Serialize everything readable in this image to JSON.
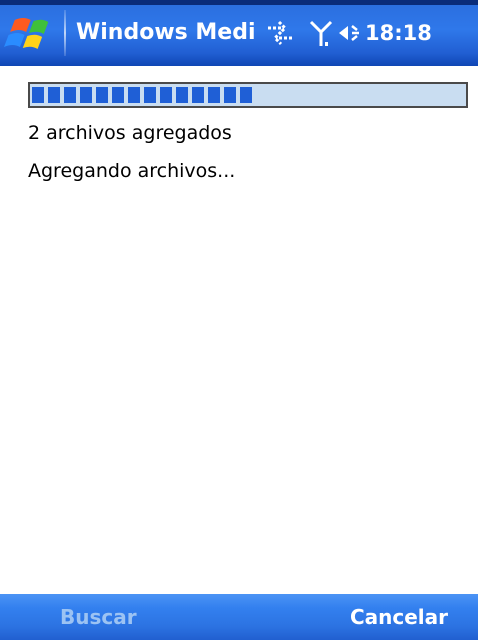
{
  "titlebar": {
    "title": "Windows Medi",
    "time": "18:18",
    "icons": [
      "windows-start-icon",
      "connectivity-icon",
      "signal-antenna-icon",
      "volume-icon"
    ]
  },
  "progress": {
    "fraction": 0.51
  },
  "status": {
    "files_added": "2 archivos agregados",
    "action": "Agregando archivos..."
  },
  "menubar": {
    "left_softkey": "Buscar",
    "right_softkey": "Cancelar"
  },
  "colors": {
    "title_bar": "#2f78ea",
    "progress_fill": "#1f5fd6",
    "progress_track": "#c9ddf1",
    "softkey_disabled": "#9cc3f3"
  }
}
